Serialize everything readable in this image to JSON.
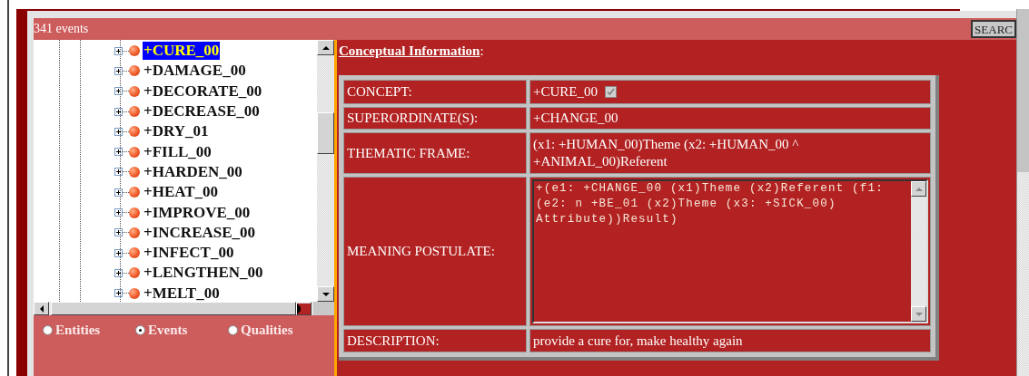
{
  "header": {
    "count": "341 events",
    "search_button": "SEARC"
  },
  "tree": {
    "items": [
      {
        "label": "+CURE_00",
        "selected": true
      },
      {
        "label": "+DAMAGE_00",
        "selected": false
      },
      {
        "label": "+DECORATE_00",
        "selected": false
      },
      {
        "label": "+DECREASE_00",
        "selected": false
      },
      {
        "label": "+DRY_01",
        "selected": false
      },
      {
        "label": "+FILL_00",
        "selected": false
      },
      {
        "label": "+HARDEN_00",
        "selected": false
      },
      {
        "label": "+HEAT_00",
        "selected": false
      },
      {
        "label": "+IMPROVE_00",
        "selected": false
      },
      {
        "label": "+INCREASE_00",
        "selected": false
      },
      {
        "label": "+INFECT_00",
        "selected": false
      },
      {
        "label": "+LENGTHEN_00",
        "selected": false
      },
      {
        "label": "+MELT_00",
        "selected": false
      }
    ]
  },
  "radios": [
    {
      "label": "Entities",
      "selected": false
    },
    {
      "label": "Events",
      "selected": true
    },
    {
      "label": "Qualities",
      "selected": false
    }
  ],
  "details": {
    "heading": "**Conceptual Information**:",
    "rows": [
      {
        "kind": "check",
        "label": "CONCEPT:",
        "value": "+CURE_00",
        "checked": true,
        "disabled": true
      },
      {
        "kind": "text",
        "label": "SUPERORDINATE(S):",
        "value": "+CHANGE_00"
      },
      {
        "kind": "text",
        "label": "THEMATIC FRAME:",
        "value": "(x1: +HUMAN_00)Theme (x2: +HUMAN_00 ^ +ANIMAL_00)Referent"
      },
      {
        "kind": "postulate",
        "label": "MEANING POSTULATE:",
        "value": "+(e1: +CHANGE_00 (x1)Theme (x2)Referent (f1: (e2: n +BE_01 (x2)Theme (x3: +SICK_00) Attribute))Result)"
      },
      {
        "kind": "text",
        "label": "DESCRIPTION:",
        "value": "provide a cure for, make healthy again"
      }
    ]
  }
}
